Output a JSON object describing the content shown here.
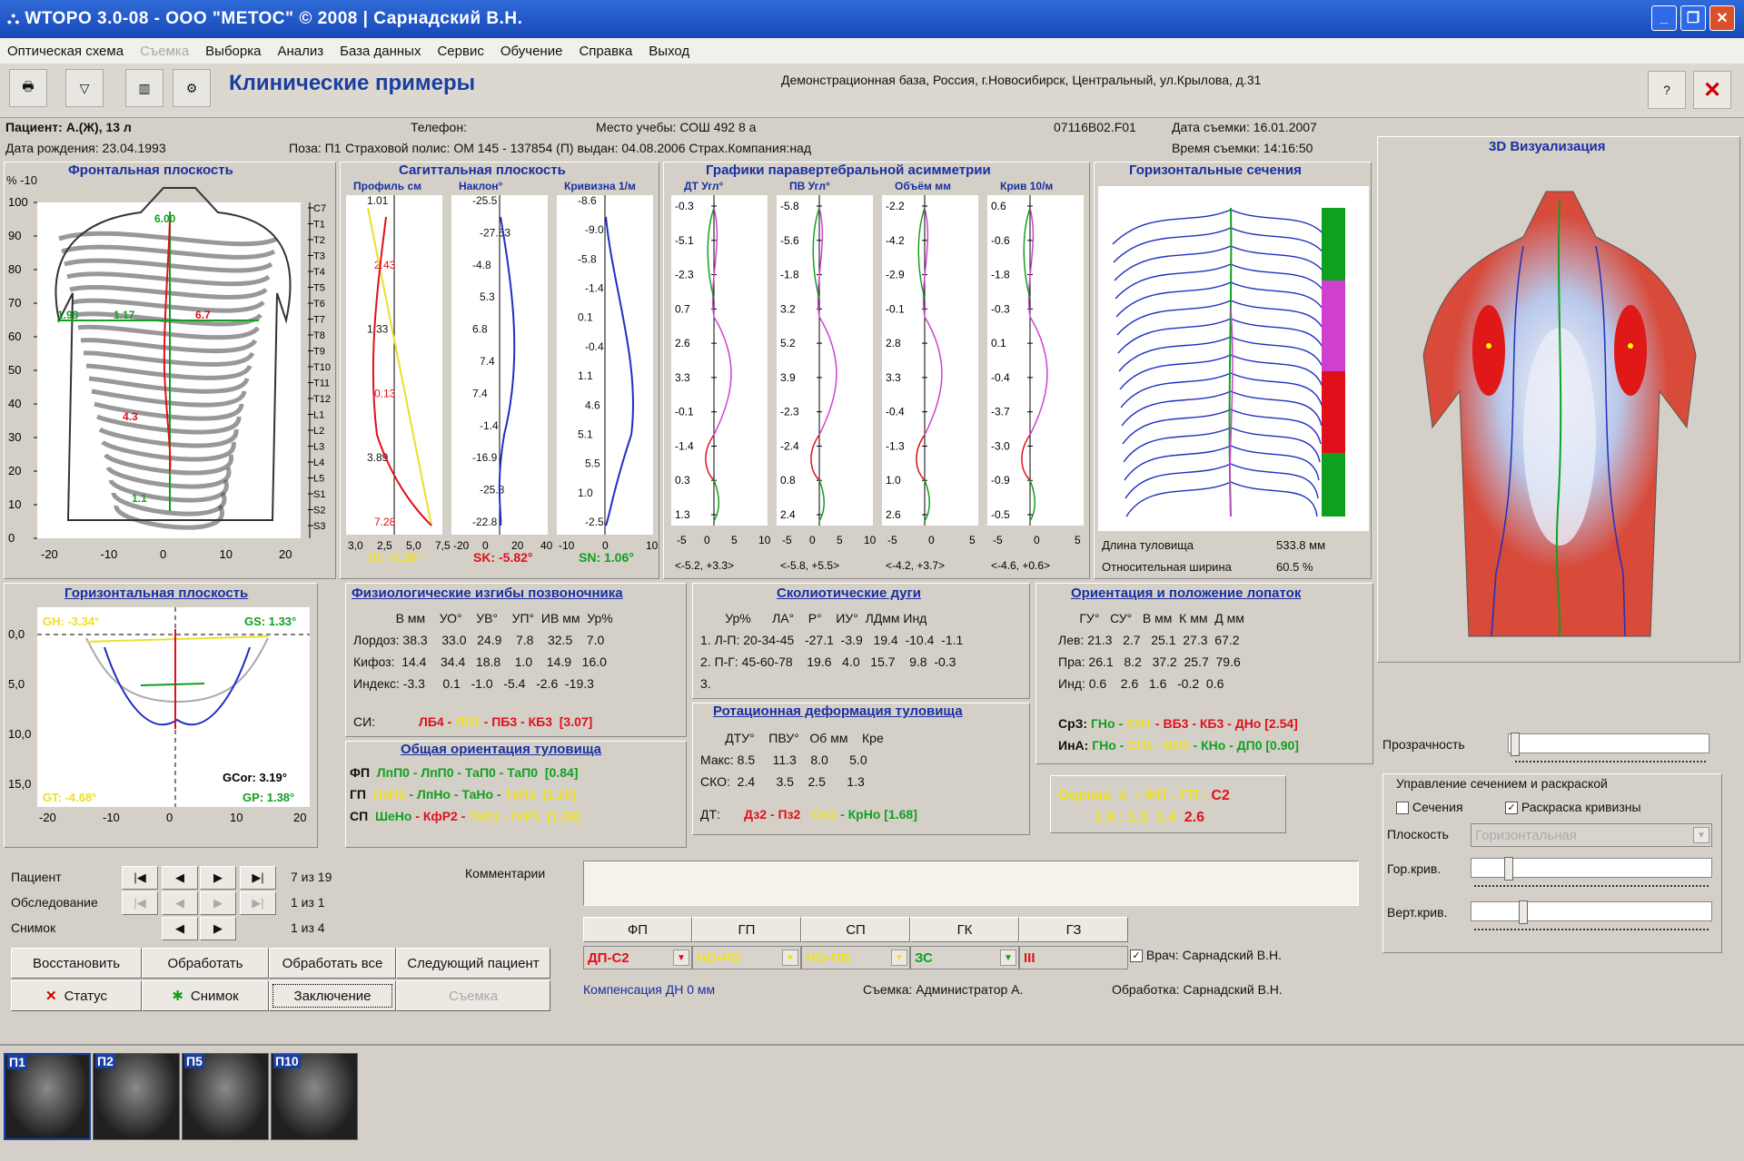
{
  "window": {
    "title": "WTOPO 3.0-08  - ООО \"МЕТОС\" © 2008   |  Сарнадский В.Н."
  },
  "menu": [
    "Оптическая схема",
    "Съемка",
    "Выборка",
    "Анализ",
    "База данных",
    "Сервис",
    "Обучение",
    "Справка",
    "Выход"
  ],
  "menu_disabled": [
    1
  ],
  "toolbar": {
    "heading": "Клинические примеры",
    "address": "Демонстрационная база, Россия, г.Новосибирск, Центральный, ул.Крылова, д.31"
  },
  "patient": {
    "name": "Пациент:  А.(Ж), 13 л",
    "phone": "Телефон:",
    "school": "Место учебы: СОШ 492 8 а",
    "code": "07116B02.F01",
    "survey_date": "Дата съемки: 16.01.2007",
    "birth": "Дата рождения: 23.04.1993",
    "pose": "Поза:  П1",
    "policy": "Страховой полис: ОМ 145 - 137854 (П) выдан: 04.08.2006 Страх.Компания:над",
    "survey_time": "Время съемки: 14:16:50"
  },
  "frontal": {
    "title": "Фронтальная плоскость",
    "pct": "% -10",
    "yticks": [
      "100",
      "90",
      "80",
      "70",
      "60",
      "50",
      "40",
      "30",
      "20",
      "10",
      "0"
    ],
    "xticks": [
      "-20",
      "-10",
      "0",
      "10",
      "20"
    ],
    "labels": [
      "6.00",
      "1.98",
      "1.17",
      "6.7",
      "4.3",
      "1.1"
    ],
    "vert": [
      "C7",
      "T1",
      "T2",
      "T3",
      "T4",
      "T5",
      "T6",
      "T7",
      "T8",
      "T9",
      "T10",
      "T11",
      "T12",
      "L1",
      "L2",
      "L3",
      "L4",
      "L5",
      "S1",
      "S2",
      "S3"
    ]
  },
  "sagittal": {
    "title": "Сагиттальная плоскость",
    "cols": [
      {
        "h": "Профиль см",
        "vals": [
          "1.01",
          "2.43",
          "1.33",
          "0.13",
          "3.89",
          "7.28"
        ],
        "x": [
          "3,0",
          "2,5",
          "5,0",
          "7,5"
        ]
      },
      {
        "h": "Наклон°",
        "vals": [
          "-25.5",
          "-27.53",
          "-4.8",
          "5.3",
          "6.8",
          "7.4",
          "7.4",
          "-1.4",
          "-16.9",
          "-25.8",
          "-22.8"
        ],
        "x": [
          "-20",
          "0",
          "20",
          "40"
        ]
      },
      {
        "h": "Кривизна 1/м",
        "vals": [
          "-8.6",
          "-9.0",
          "-5.8",
          "-1.4",
          "0.1",
          "-0.4",
          "1.1",
          "4.6",
          "5.1",
          "5.5",
          "1.0",
          "-2.5"
        ],
        "x": [
          "-10",
          "0",
          "10"
        ]
      }
    ],
    "stats": [
      {
        "t": "SI: -2.30°",
        "c": "yel"
      },
      {
        "t": "SK: -5.82°",
        "c": "red"
      },
      {
        "t": "SN: 1.06°",
        "c": "grn"
      }
    ]
  },
  "paravert": {
    "title": "Графики паравертебральной асимметрии",
    "cols": [
      {
        "h": "ДТ Угл°",
        "vals": [
          "-0.3",
          "-5.1",
          "-2.3",
          "0.7",
          "2.6",
          "3.3",
          "-0.1",
          "-1.4",
          "0.3",
          "1.3"
        ],
        "range": "<-5.2, +3.3>",
        "x": [
          "-5",
          "0",
          "5",
          "10"
        ]
      },
      {
        "h": "ПВ Угл°",
        "vals": [
          "-5.8",
          "-5.6",
          "-1.8",
          "3.2",
          "5.2",
          "3.9",
          "-2.3",
          "-2.4",
          "0.8",
          "2.4"
        ],
        "range": "<-5.8, +5.5>",
        "x": [
          "-5",
          "0",
          "5",
          "10"
        ]
      },
      {
        "h": "Объём мм",
        "vals": [
          "-2.2",
          "-4.2",
          "-2.9",
          "-0.1",
          "2.8",
          "3.3",
          "-0.4",
          "-1.3",
          "1.0",
          "2.6"
        ],
        "range": "<-4.2, +3.7>",
        "x": [
          "-5",
          "0",
          "5"
        ]
      },
      {
        "h": "Крив 10/м",
        "vals": [
          "0.6",
          "-0.6",
          "-1.8",
          "-0.3",
          "0.1",
          "-0.4",
          "-3.7",
          "-3.0",
          "-0.9",
          "-0.5"
        ],
        "range": "<-4.6, +0.6>",
        "x": [
          "-5",
          "0",
          "5"
        ]
      }
    ]
  },
  "horiz_sections": {
    "title": "Горизонтальные сечения",
    "len_label": "Длина туловища",
    "len_val": "533.8 мм",
    "width_label": "Относительная ширина",
    "width_val": "60.5 %"
  },
  "viz3d": {
    "title": "3D Визуализация"
  },
  "horiz_plane": {
    "title": "Горизонтальная плоскость",
    "gh": "GH: -3.34°",
    "gs": "GS: 1.33°",
    "gt": "GT: -4.68°",
    "gcor": "GCor: 3.19°",
    "gp": "GP: 1.38°",
    "yticks": [
      "0,0",
      "5,0",
      "10,0",
      "15,0"
    ],
    "xticks": [
      "-20",
      "-10",
      "0",
      "10",
      "20"
    ]
  },
  "physio": {
    "title": "Физиологические изгибы позвоночника",
    "header": "            В мм    УО°    УВ°    УП°  ИВ мм  Ур%",
    "rows": [
      "Лордоз: 38.3    33.0   24.9    7.8    32.5    7.0",
      "Кифоз:  14.4    34.4   18.8    1.0    14.9   16.0",
      "Индекс: -3.3     0.1   -1.0   -5.4   -2.6  -19.3"
    ],
    "si_label": "СИ:",
    "si": [
      {
        "t": "ЛБ4",
        "c": "red"
      },
      {
        "t": " - ",
        "c": "red"
      },
      {
        "t": "ЛБ1",
        "c": "yel"
      },
      {
        "t": " - ПБ3 - КБ3  ",
        "c": "red"
      },
      {
        "t": "[3.07]",
        "c": "red"
      }
    ]
  },
  "orient": {
    "title": "Общая ориентация туловища",
    "rows": [
      [
        {
          "t": "ФП  ",
          "c": "blk"
        },
        {
          "t": "ЛпП0",
          "c": "grn"
        },
        {
          "t": " - ЛпП0 - ТаП0 - ТаП0  ",
          "c": "grn"
        },
        {
          "t": "[0.84]",
          "c": "grn"
        }
      ],
      [
        {
          "t": "ГП  ",
          "c": "blk"
        },
        {
          "t": "ЛаП1",
          "c": "yel"
        },
        {
          "t": " - ЛпНо - ТаНо - ",
          "c": "grn"
        },
        {
          "t": "ТаП1  [1.20]",
          "c": "yel"
        }
      ],
      [
        {
          "t": "СП  ",
          "c": "blk"
        },
        {
          "t": "ШеНо",
          "c": "grn"
        },
        {
          "t": " - КфР2 - ",
          "c": "red"
        },
        {
          "t": "ТаП1 - ГеР1  [1.55]",
          "c": "yel"
        }
      ]
    ]
  },
  "scolio": {
    "title": "Сколиотические дуги",
    "header": "       Ур%      ЛА°    Р°    ИУ°  ЛДмм Инд",
    "rows": [
      "1. Л-П: 20-34-45   -27.1  -3.9   19.4  -10.4  -1.1",
      "2. П-Г: 45-60-78    19.6   4.0   15.7    9.8  -0.3",
      "3."
    ]
  },
  "rotation": {
    "title": "Ротационная деформация туловища",
    "header": "       ДТУ°    ПВУ°   Об мм    Кре",
    "rows": [
      "Макс: 8.5     11.3    8.0      5.0",
      "СКО:  2.4      3.5    2.5      1.3"
    ],
    "dt_label": "ДТ:",
    "dt": [
      {
        "t": "Дз2",
        "c": "red"
      },
      {
        "t": " - ",
        "c": "red"
      },
      {
        "t": "Пз2",
        "c": "red"
      },
      {
        "t": " - ",
        "c": "yel"
      },
      {
        "t": "Ол1",
        "c": "yel"
      },
      {
        "t": " - ",
        "c": "grn"
      },
      {
        "t": "КрНо [1.68]",
        "c": "grn"
      }
    ]
  },
  "blades": {
    "title": "Ориентация и положение лопаток",
    "header": "      ГУ°   СУ°   В мм  К мм  Д мм",
    "rows": [
      "Лев: 21.3   2.7   25.1  27.3  67.2",
      "Пра: 26.1   8.2   37.2  25.7  79.6",
      "Инд: 0.6    2.6   1.6   -0.2  0.6"
    ],
    "sr": [
      {
        "t": "СрЗ: ",
        "c": "blk"
      },
      {
        "t": "ГНо - ",
        "c": "grn"
      },
      {
        "t": "СН1",
        "c": "yel"
      },
      {
        "t": " - ВБ3 - КБ3 ",
        "c": "red"
      },
      {
        "t": "- ДНо [2.54]",
        "c": "red"
      }
    ],
    "ina": [
      {
        "t": "ИнА: ",
        "c": "blk"
      },
      {
        "t": "ГНо - ",
        "c": "grn"
      },
      {
        "t": "СП1 - ВП1",
        "c": "yel"
      },
      {
        "t": " - КНо - ДП0 [0.90]",
        "c": "grn"
      }
    ]
  },
  "grade": {
    "l1": [
      {
        "t": "Оценка  1  : ФП - ГП - ",
        "c": "yel"
      },
      {
        "t": "С2",
        "c": "red"
      }
    ],
    "l2": [
      {
        "t": "1.9 : 1.3  1.4  ",
        "c": "yel"
      },
      {
        "t": "2.6",
        "c": "red"
      }
    ]
  },
  "right": {
    "transparency": "Прозрачность",
    "ctrl_title": "Управление сечением и раскраской",
    "sections": "Сечения",
    "coloring": "Раскраска кривизны",
    "plane": "Плоскость",
    "plane_val": "Горизонтальная",
    "hor": "Гор.крив.",
    "vert": "Верт.крив."
  },
  "nav": {
    "patient": "Пациент",
    "exam": "Обследование",
    "shot": "Снимок",
    "patient_cnt": "7 из  19",
    "exam_cnt": "1 из   1",
    "shot_cnt": "1 из   4"
  },
  "buttons": {
    "restore": "Восстановить",
    "process": "Обработать",
    "process_all": "Обработать все",
    "next": "Следующий пациент",
    "status": "Статус",
    "shot": "Снимок",
    "conclusion": "Заключение",
    "survey": "Съемка"
  },
  "comment_label": "Комментарии",
  "grid": {
    "headers": [
      "ФП",
      "ГП",
      "СП",
      "ГК",
      "ГЗ"
    ],
    "values": [
      {
        "t": "ДП-С2",
        "c": "red"
      },
      {
        "t": "НО-РО",
        "c": "yel"
      },
      {
        "t": "НО-ПВ",
        "c": "yel"
      },
      {
        "t": "ЗС",
        "c": "grn"
      },
      {
        "t": "III",
        "c": "red"
      }
    ],
    "doctor": "Врач: Сарнадский В.Н."
  },
  "footer": {
    "comp": "Компенсация ДН    0 мм",
    "surveyed": "Съемка: Администратор А.",
    "processed": "Обработка: Сарнадский В.Н."
  },
  "thumbs": [
    "П1",
    "П2",
    "П5",
    "П10"
  ],
  "colors": {
    "title_bar": "#1f56c8",
    "heading": "#1a3fa0",
    "red": "#e0101a",
    "yellow": "#f0e020",
    "green": "#10a020"
  }
}
